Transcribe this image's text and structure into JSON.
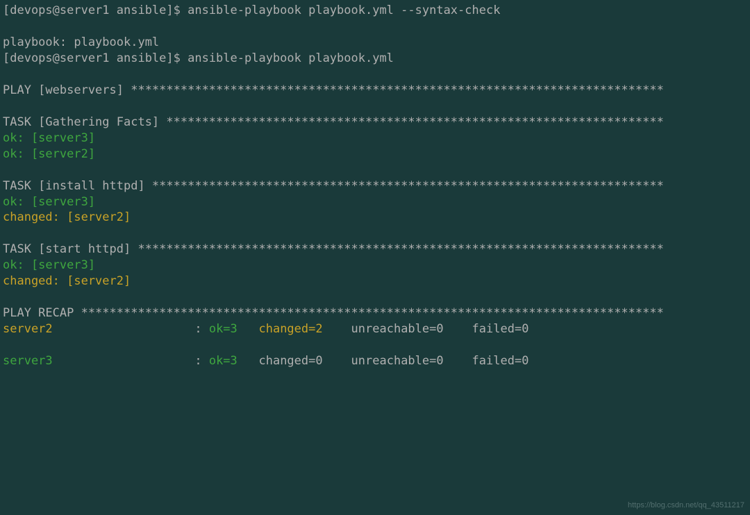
{
  "prompt1": "[devops@server1 ansible]$ ",
  "cmd1": "ansible-playbook playbook.yml --syntax-check",
  "playbook_label": "playbook: playbook.yml",
  "prompt2": "[devops@server1 ansible]$ ",
  "cmd2": "ansible-playbook playbook.yml",
  "play_header": "PLAY [webservers] ***************************************************************************",
  "task_gather": "TASK [Gathering Facts] **********************************************************************",
  "ok_server3": "ok: [server3]",
  "ok_server2": "ok: [server2]",
  "task_install": "TASK [install httpd] ************************************************************************",
  "changed_server2": "changed: [server2]",
  "task_start": "TASK [start httpd] **************************************************************************",
  "recap_header": "PLAY RECAP **********************************************************************************",
  "recap": {
    "server2": {
      "host_pad": "server2                    ",
      "colon": ": ",
      "ok": "ok=3   ",
      "changed": "changed=2    ",
      "unreachable": "unreachable=0    ",
      "failed": "failed=0"
    },
    "server3": {
      "host_pad": "server3                    ",
      "colon": ": ",
      "ok": "ok=3   ",
      "changed": "changed=0    ",
      "unreachable": "unreachable=0    ",
      "failed": "failed=0"
    }
  },
  "watermark": "https://blog.csdn.net/qq_43511217"
}
